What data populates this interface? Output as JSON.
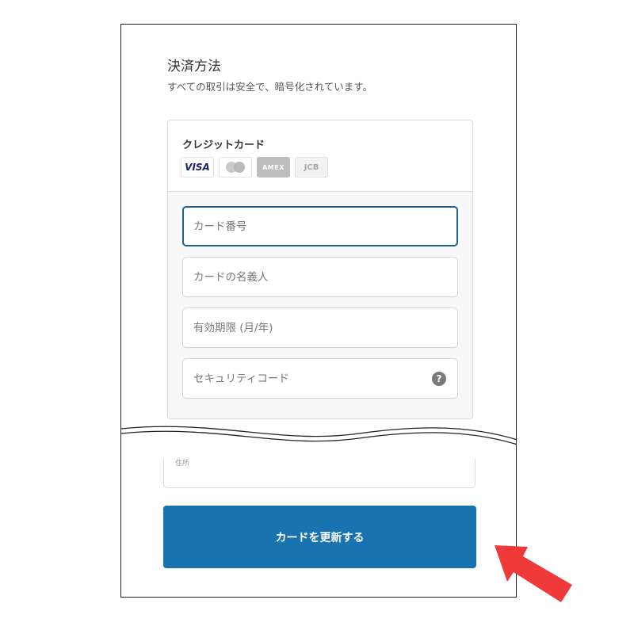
{
  "page": {
    "title": "決済方法",
    "subtitle": "すべての取引は安全で、暗号化されています。"
  },
  "card": {
    "title": "クレジットカード",
    "brands": [
      "VISA",
      "mastercard",
      "AMEX",
      "JCB"
    ],
    "fields": {
      "number_placeholder": "カード番号",
      "name_placeholder": "カードの名義人",
      "expiry_placeholder": "有効期限 (月/年)",
      "cvc_placeholder": "セキュリティコード",
      "cvc_help_glyph": "?"
    }
  },
  "lower": {
    "partial_label": "住所"
  },
  "actions": {
    "submit_label": "カードを更新する"
  },
  "colors": {
    "accent": "#1a73b1",
    "focus_border": "#1e5f8c",
    "annotation_arrow": "#f03a3a"
  },
  "icons": {
    "help": "question-circle-icon",
    "annotation": "red-arrow-icon"
  }
}
